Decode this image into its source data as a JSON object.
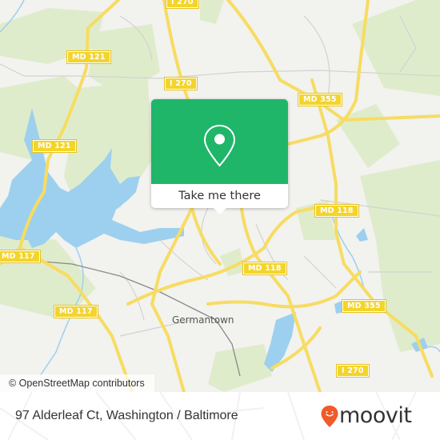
{
  "map": {
    "colors": {
      "land": "#f2f2ef",
      "park": "#dfeccb",
      "water": "#9dd0ee",
      "road_major": "#f7dc62",
      "road_minor": "#d2d2d2",
      "rail": "#888888",
      "accent": "#1fb66a"
    },
    "road_shields": [
      {
        "id": "i270-top",
        "label": "I 270"
      },
      {
        "id": "md121-top",
        "label": "MD 121"
      },
      {
        "id": "i270-mid",
        "label": "I 270"
      },
      {
        "id": "md355-top",
        "label": "MD 355"
      },
      {
        "id": "md121-left",
        "label": "MD 121"
      },
      {
        "id": "md118-right",
        "label": "MD 118"
      },
      {
        "id": "md117-left",
        "label": "MD 117"
      },
      {
        "id": "md118-center",
        "label": "MD 118"
      },
      {
        "id": "md117-bottom",
        "label": "MD 117"
      },
      {
        "id": "md355-bottom",
        "label": "MD 355"
      },
      {
        "id": "i270-bottom",
        "label": "I 270"
      }
    ],
    "place_labels": [
      {
        "id": "germantown",
        "label": "Germantown"
      }
    ],
    "attribution": "© OpenStreetMap contributors"
  },
  "popup": {
    "icon": "location-pin-icon",
    "button_label": "Take me there"
  },
  "footer": {
    "address": "97 Alderleaf Ct, Washington / Baltimore",
    "brand": "moovit",
    "brand_color": "#f15a29"
  }
}
